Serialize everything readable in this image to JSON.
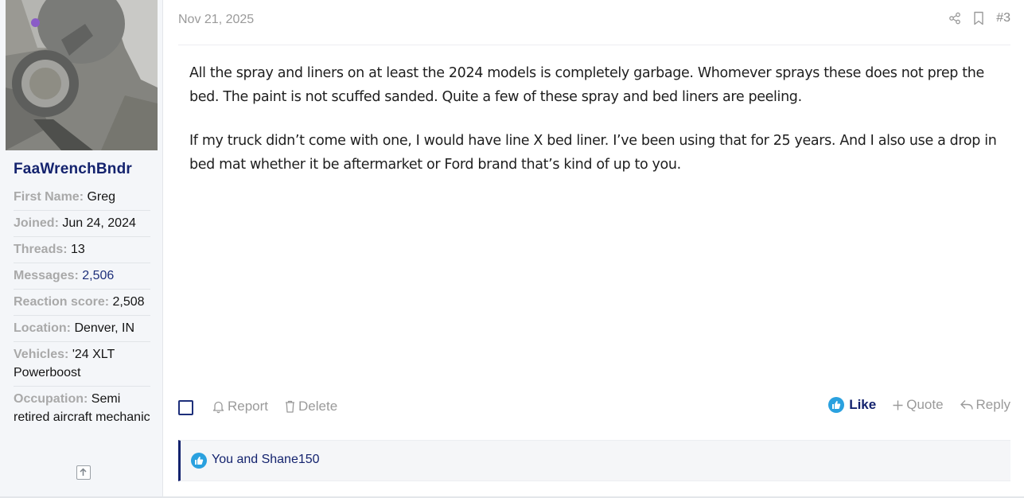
{
  "user": {
    "username": "FaaWrenchBndr",
    "online_status_color": "#8a5cc7",
    "info": [
      {
        "key": "First Name:",
        "value": "Greg"
      },
      {
        "key": "Joined:",
        "value": "Jun 24, 2024"
      },
      {
        "key": "Threads:",
        "value": "13"
      },
      {
        "key": "Messages:",
        "value": "2,506"
      },
      {
        "key": "Reaction score:",
        "value": "2,508"
      },
      {
        "key": "Location:",
        "value": "Denver, IN"
      },
      {
        "key": "Vehicles:",
        "value": "'24 XLT Powerboost"
      },
      {
        "key": "Occupation:",
        "value": "Semi retired aircraft mechanic"
      }
    ]
  },
  "post": {
    "date": "Nov 21, 2025",
    "number": "#3",
    "paragraphs": [
      "All the spray and liners on at least the 2024 models is completely garbage. Whomever sprays these does not prep the bed. The paint is not scuffed sanded. Quite a few of these spray and bed liners are peeling.",
      "If my truck didn’t come with one, I would have line X bed liner. I’ve been using that for 25 years. And I also use a drop in bed mat whether it be aftermarket or Ford brand that’s kind of up to you."
    ]
  },
  "actions": {
    "report": "Report",
    "delete": "Delete",
    "like": "Like",
    "quote": "Quote",
    "reply": "Reply"
  },
  "reactions": {
    "text": "You and Shane150"
  },
  "colors": {
    "brand_navy": "#14236e",
    "like_blue": "#2aa1df",
    "muted": "#9a9a9a"
  }
}
